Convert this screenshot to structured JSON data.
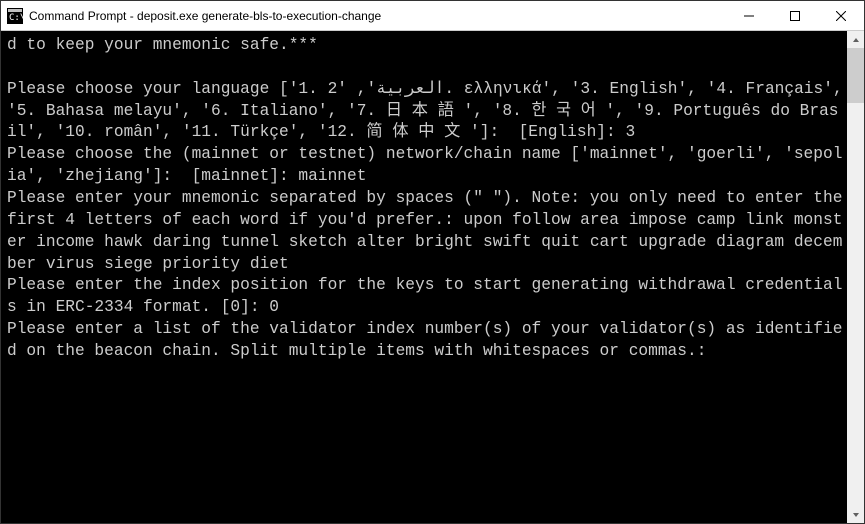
{
  "titlebar": {
    "title": "Command Prompt - deposit.exe  generate-bls-to-execution-change"
  },
  "terminal": {
    "content": "d to keep your mnemonic safe.***\n\nPlease choose your language ['1. العربية', '2. ελληνικά', '3. English', '4. Français', '5. Bahasa melayu', '6. Italiano', '7. 日 本 語 ', '8. 한 국 어 ', '9. Português do Brasil', '10. român', '11. Türkçe', '12. 简 体 中 文 ']:  [English]: 3\nPlease choose the (mainnet or testnet) network/chain name ['mainnet', 'goerli', 'sepolia', 'zhejiang']:  [mainnet]: mainnet\nPlease enter your mnemonic separated by spaces (\" \"). Note: you only need to enter the first 4 letters of each word if you'd prefer.: upon follow area impose camp link monster income hawk daring tunnel sketch alter bright swift quit cart upgrade diagram december virus siege priority diet\nPlease enter the index position for the keys to start generating withdrawal credentials in ERC-2334 format. [0]: 0\nPlease enter a list of the validator index number(s) of your validator(s) as identified on the beacon chain. Split multiple items with whitespaces or commas.:"
  }
}
